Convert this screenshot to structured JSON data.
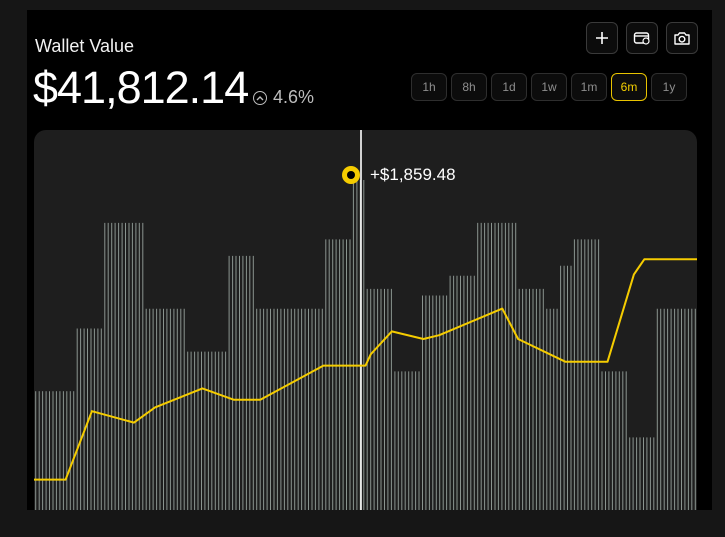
{
  "wallet": {
    "title": "Wallet Value",
    "value": "$41,812.14",
    "change": "4.6%"
  },
  "toolbar": [
    {
      "icon": "plus-icon"
    },
    {
      "icon": "wallet-sync-icon"
    },
    {
      "icon": "camera-icon"
    }
  ],
  "ranges": [
    "1h",
    "8h",
    "1d",
    "1w",
    "1m",
    "6m",
    "1y"
  ],
  "active_range": "6m",
  "tooltip": {
    "label": "+$1,859.48"
  },
  "colors": {
    "accent": "#F5CC00",
    "bars": "#8a948f",
    "background": "#000000",
    "plot_background": "#1e1e1e"
  },
  "chart_data": {
    "type": "line",
    "x": [
      0,
      0.6,
      1.1,
      1.9,
      2.3,
      3.2,
      3.8,
      4.3,
      5.5,
      6.2,
      6.3,
      6.4,
      6.8,
      7.4,
      7.7,
      8.9,
      9.2,
      10.1,
      10.7,
      10.9,
      11.4,
      11.6,
      12.6,
      12.6
    ],
    "y": [
      0.08,
      0.08,
      0.26,
      0.23,
      0.27,
      0.32,
      0.29,
      0.29,
      0.38,
      0.38,
      0.38,
      0.41,
      0.47,
      0.45,
      0.46,
      0.53,
      0.45,
      0.39,
      0.39,
      0.39,
      0.62,
      0.66,
      0.66,
      0.66
    ],
    "volume": {
      "type": "bar",
      "values": [
        0.36,
        0.36,
        0.36,
        0.55,
        0.55,
        0.87,
        0.87,
        0.87,
        0.61,
        0.61,
        0.61,
        0.48,
        0.48,
        0.48,
        0.77,
        0.77,
        0.61,
        0.61,
        0.61,
        0.61,
        0.61,
        0.82,
        0.82,
        1.0,
        0.67,
        0.67,
        0.42,
        0.42,
        0.65,
        0.65,
        0.71,
        0.71,
        0.87,
        0.87,
        0.87,
        0.67,
        0.67,
        0.61,
        0.74,
        0.82,
        0.82,
        0.42,
        0.42,
        0.22,
        0.22,
        0.61,
        0.61,
        0.61
      ]
    }
  }
}
